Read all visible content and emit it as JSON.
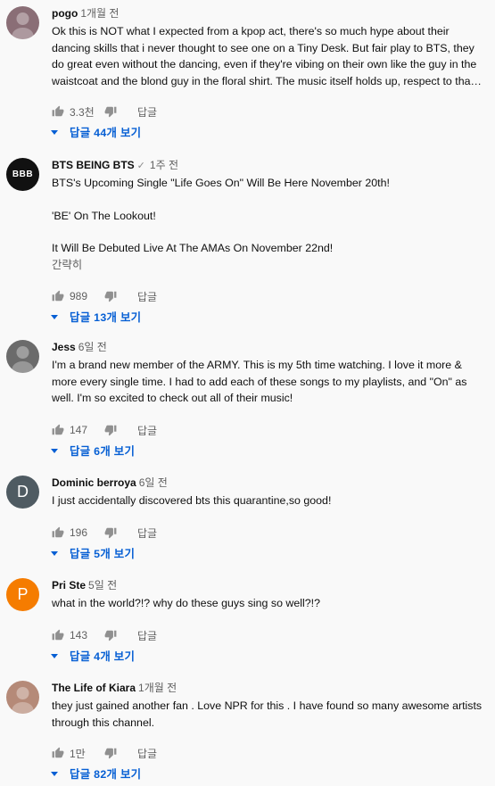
{
  "colors": {
    "link_blue": "#065fd4",
    "secondary_text": "#606060",
    "background": "#f9f9f9"
  },
  "comments": [
    {
      "author": "pogo",
      "time": "1개월 전",
      "verified": false,
      "avatar": {
        "type": "photo",
        "color": "#8a6e76"
      },
      "paragraphs": [
        "Ok this is NOT what I expected from a kpop act, there's so much hype about their dancing skills that i never thought to see one on a Tiny Desk. But fair play to BTS, they do great even without the dancing, even if they're vibing on their own like the guy in the waistcoat and the blond guy in the floral shirt. The music itself holds up, respect to tha…"
      ],
      "read_more": "",
      "likes": "3.3천",
      "reply_label": "답글",
      "replies_label": "답글 44개 보기"
    },
    {
      "author": "BTS BEING BTS",
      "time": "1주 전",
      "verified": true,
      "avatar": {
        "type": "text",
        "text": "BBB",
        "color": "#111111"
      },
      "paragraphs": [
        "BTS's Upcoming Single \"Life Goes On\" Will Be Here November 20th!",
        "'BE' On The Lookout!",
        "It Will Be Debuted Live At The AMAs On November 22nd!"
      ],
      "read_more": "간략히",
      "likes": "989",
      "reply_label": "답글",
      "replies_label": "답글 13개 보기"
    },
    {
      "author": "Jess",
      "time": "6일 전",
      "verified": false,
      "avatar": {
        "type": "photo",
        "color": "#6b6b6b"
      },
      "paragraphs": [
        "I'm a brand new member of the ARMY. This is my 5th time watching. I love it more & more every single time. I had to add each of these songs to my playlists, and \"On\" as well. I'm so excited to check out all of their music!"
      ],
      "read_more": "",
      "likes": "147",
      "reply_label": "답글",
      "replies_label": "답글 6개 보기"
    },
    {
      "author": "Dominic berroya",
      "time": "6일 전",
      "verified": false,
      "avatar": {
        "type": "letter",
        "text": "D",
        "color": "#4f5b62"
      },
      "paragraphs": [
        "I just accidentally discovered bts this quarantine,so good!"
      ],
      "read_more": "",
      "likes": "196",
      "reply_label": "답글",
      "replies_label": "답글 5개 보기"
    },
    {
      "author": "Pri Ste",
      "time": "5일 전",
      "verified": false,
      "avatar": {
        "type": "letter",
        "text": "P",
        "color": "#f57c00"
      },
      "paragraphs": [
        "what in the world?!? why do these guys sing so well?!?"
      ],
      "read_more": "",
      "likes": "143",
      "reply_label": "답글",
      "replies_label": "답글 4개 보기"
    },
    {
      "author": "The Life of Kiara",
      "time": "1개월 전",
      "verified": false,
      "avatar": {
        "type": "photo",
        "color": "#b58a78"
      },
      "paragraphs": [
        "they just gained another fan . Love NPR for this . I have found so many awesome artists through this channel."
      ],
      "read_more": "",
      "likes": "1만",
      "reply_label": "답글",
      "replies_label": "답글 82개 보기"
    }
  ]
}
